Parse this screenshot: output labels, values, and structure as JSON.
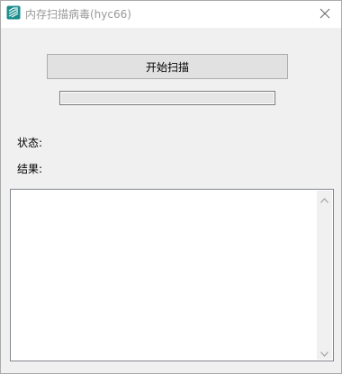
{
  "window": {
    "title": "内存扫描病毒(hyc66)",
    "icon": "app-logo-icon",
    "close_icon": "close-icon"
  },
  "main": {
    "start_button_label": "开始扫描",
    "progress_fraction": 0.0,
    "status_label": "状态:",
    "status_value": "",
    "result_label": "结果:",
    "result_value": "",
    "output_text": ""
  },
  "colors": {
    "accent_icon": "#1a8c8c",
    "progress_fill": "#06b025"
  }
}
